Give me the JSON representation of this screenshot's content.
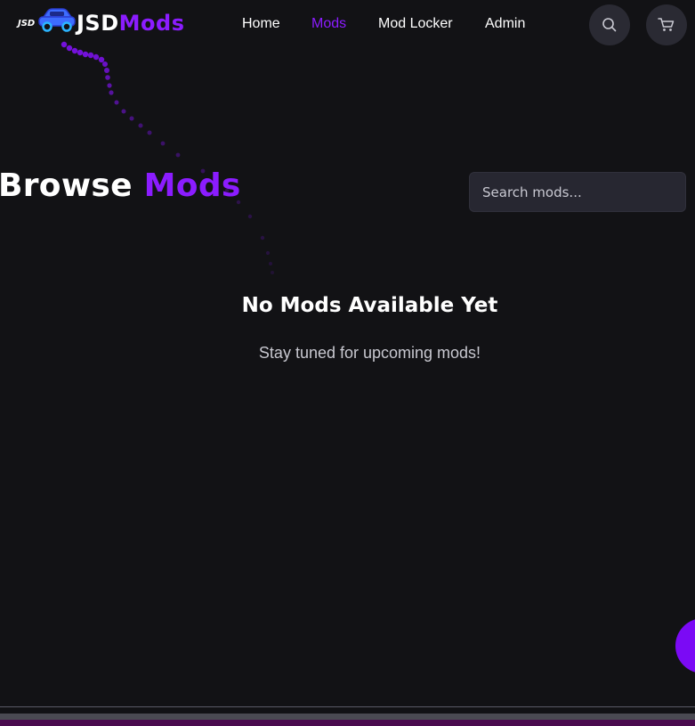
{
  "header": {
    "logo_small_text": "JSD",
    "brand_primary": "JSD",
    "brand_accent": "Mods",
    "nav": [
      {
        "label": "Home",
        "active": false
      },
      {
        "label": "Mods",
        "active": true
      },
      {
        "label": "Mod Locker",
        "active": false
      },
      {
        "label": "Admin",
        "active": false
      }
    ],
    "icons": [
      "search-icon",
      "cart-icon"
    ]
  },
  "main": {
    "title_primary": "Browse",
    "title_accent": "Mods",
    "search": {
      "placeholder": "Search mods...",
      "value": ""
    },
    "empty_title": "No Mods Available Yet",
    "empty_subtitle": "Stay tuned for upcoming mods!"
  },
  "colors": {
    "background": "#121215",
    "accent": "#8b1cff",
    "button_bg": "#2a2a33",
    "input_bg": "#272731",
    "fab": "#7b0af5"
  }
}
